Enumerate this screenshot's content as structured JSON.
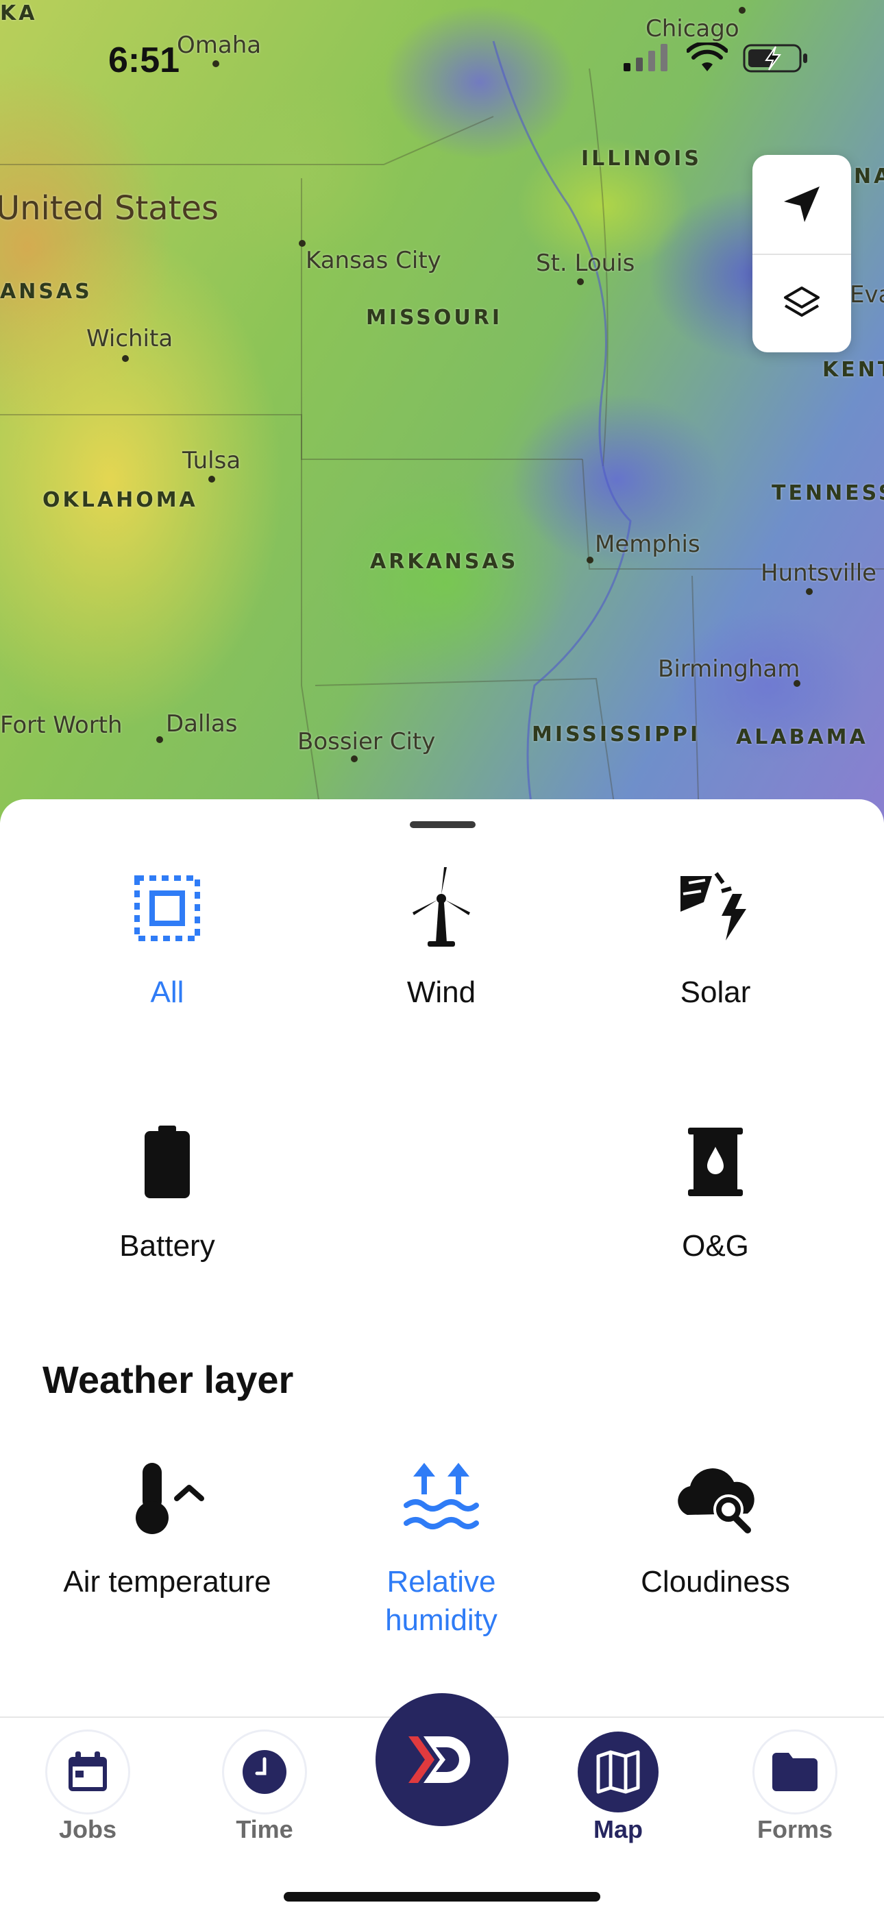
{
  "status_bar": {
    "time": "6:51"
  },
  "map": {
    "country_label": "United States",
    "states": [
      "KANSAS",
      "MISSOURI",
      "ILLINOIS",
      "OKLAHOMA",
      "ARKANSAS",
      "MISSISSIPPI",
      "ALABAMA",
      "TENNESSEE",
      "KENTUCKY",
      "INDIANA"
    ],
    "cities": [
      "Omaha",
      "Chicago",
      "Kansas City",
      "St. Louis",
      "Wichita",
      "Tulsa",
      "Memphis",
      "Huntsville",
      "Birmingham",
      "Fort Worth",
      "Dallas",
      "Bossier City",
      "Evansville"
    ],
    "state_fragments": {
      "top_left": "KA",
      "left": "ANSAS",
      "right_top": "NA",
      "right_mid": "KENT",
      "right_low": "TENNESS",
      "city_right": "Evansvi"
    },
    "controls": [
      "location-arrow-icon",
      "layers-icon"
    ]
  },
  "filters": {
    "items": [
      {
        "label": "All",
        "icon": "select-all-icon",
        "active": true
      },
      {
        "label": "Wind",
        "icon": "wind-turbine-icon",
        "active": false
      },
      {
        "label": "Solar",
        "icon": "solar-icon",
        "active": false
      },
      {
        "label": "Battery",
        "icon": "battery-icon",
        "active": false
      },
      {
        "label": "O&G",
        "icon": "oil-barrel-icon",
        "active": false
      }
    ]
  },
  "weather": {
    "heading": "Weather layer",
    "items": [
      {
        "label": "Air temperature",
        "icon": "thermometer-icon",
        "active": false
      },
      {
        "label": "Relative humidity",
        "icon": "humidity-icon",
        "active": true
      },
      {
        "label": "Cloudiness",
        "icon": "cloud-search-icon",
        "active": false
      }
    ]
  },
  "tabbar": {
    "items": [
      {
        "label": "Jobs",
        "icon": "calendar-icon",
        "active": false
      },
      {
        "label": "Time",
        "icon": "clock-icon",
        "active": false
      },
      {
        "label": "Map",
        "icon": "map-icon",
        "active": true
      },
      {
        "label": "Forms",
        "icon": "folder-icon",
        "active": false
      }
    ],
    "center_icon": "brand-logo-icon"
  },
  "colors": {
    "accent": "#2f7cf6",
    "brand": "#262660",
    "brand_red": "#e03a3e"
  }
}
